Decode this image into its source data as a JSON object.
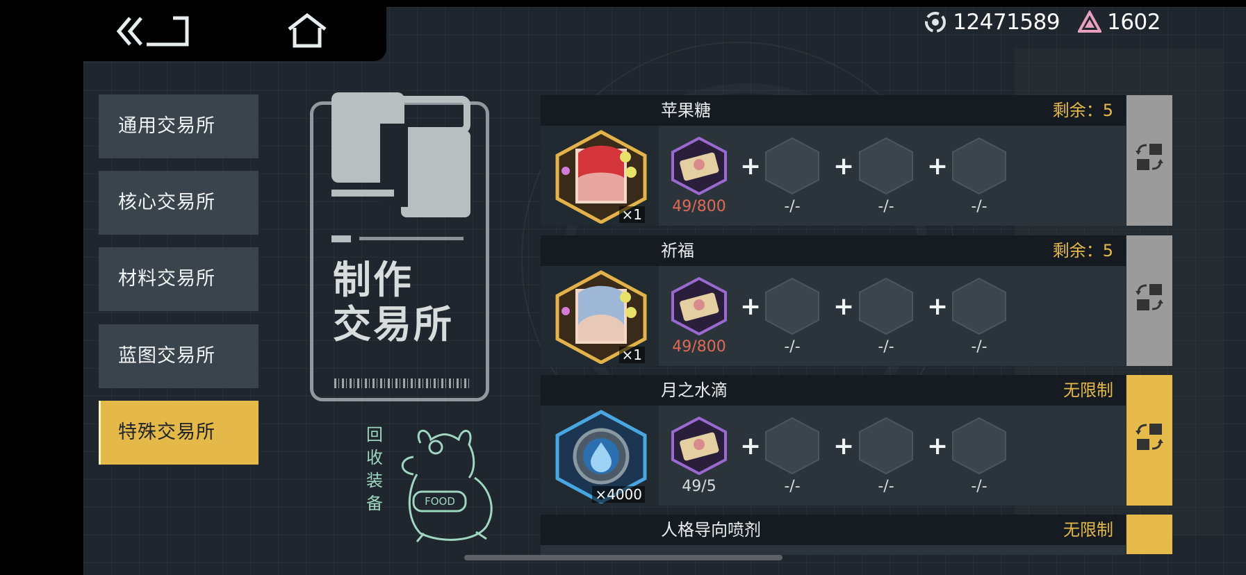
{
  "currencies": [
    {
      "icon": "credit-coin-icon",
      "value": "12471589"
    },
    {
      "icon": "gem-triangle-icon",
      "value": "1602"
    }
  ],
  "tabs": [
    {
      "label": "通用交易所",
      "active": false
    },
    {
      "label": "核心交易所",
      "active": false
    },
    {
      "label": "材料交易所",
      "active": false
    },
    {
      "label": "蓝图交易所",
      "active": false
    },
    {
      "label": "特殊交易所",
      "active": true
    }
  ],
  "shop": {
    "title_line1": "制作",
    "title_line2": "交易所",
    "recycle_text": "回收装备",
    "mascot_label": "FOOD"
  },
  "recipes": [
    {
      "name": "苹果糖",
      "limit": "剩余：5",
      "result_icon": "character-red-hair-icon",
      "result_qty": "×1",
      "ingredients": [
        "49/800",
        "-/-",
        "-/-",
        "-/-"
      ],
      "exchange_enabled": false
    },
    {
      "name": "祈福",
      "limit": "剩余：5",
      "result_icon": "character-blue-hair-icon",
      "result_qty": "×1",
      "ingredients": [
        "49/800",
        "-/-",
        "-/-",
        "-/-"
      ],
      "exchange_enabled": false
    },
    {
      "name": "月之水滴",
      "limit": "无限制",
      "result_icon": "water-drop-icon",
      "result_qty": "×4000",
      "ingredients": [
        "49/5",
        "-/-",
        "-/-",
        "-/-"
      ],
      "exchange_enabled": true
    },
    {
      "name": "人格导向喷剂",
      "limit": "无限制",
      "exchange_enabled": true
    }
  ],
  "colors": {
    "accent": "#e5b84a",
    "panel": "#1f262d",
    "insufficient": "#e06a55"
  }
}
